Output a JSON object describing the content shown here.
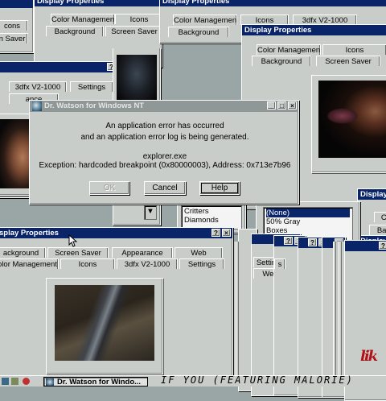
{
  "props": {
    "title": "Display Properties",
    "tab_color": "Color Management",
    "tab_icons": "Icons",
    "tab_3dfx": "3dfx V2-1000",
    "tab_background": "Background",
    "tab_screensaver": "Screen Saver",
    "tab_appearance": "Appearance",
    "tab_web": "Web",
    "tab_settings": "Settings",
    "frag_cons": "cons",
    "frag_saver": "n Saver",
    "frag_ance": "ance",
    "frag_3dfx": "3dfx V2-1000",
    "frag_ackground": "ackground",
    "frag_olor": "olor Management",
    "frag_display": "Display",
    "frag_co": "Co",
    "frag_bac": "Bac",
    "frag_splay": "splay Properties",
    "frag_layer": "Display Properties"
  },
  "list_patterns": {
    "items": [
      "Critters",
      "Diamonds"
    ]
  },
  "list_wallpaper": {
    "items": [
      "(None)",
      "50% Gray",
      "Boxes"
    ]
  },
  "small_tabs": {
    "settings": "Settings",
    "web": "Web",
    "frag_s": "s"
  },
  "dialog": {
    "title": "Dr. Watson for Windows NT",
    "line1": "An application error has occurred",
    "line2": "and an application error log is being generated.",
    "line3": "explorer.exe",
    "line4": "Exception: hardcoded breakpoint (0x80000003), Address: 0x713e7b96",
    "ok": "OK",
    "cancel": "Cancel",
    "help": "Help"
  },
  "taskbar": {
    "task_label": "Dr. Watson for Windo..."
  },
  "overlay": {
    "text": "IF YOU (FEATURING MALORIE)",
    "logo_mark": "lik"
  },
  "glyphs": {
    "help": "?",
    "close": "×",
    "min": "_",
    "max": "□",
    "scroll_down": "▼"
  },
  "colors": {
    "titlebar": "#0a246a",
    "face": "#c9cdca",
    "desktop": "#9aa6a6",
    "logo": "#b01218"
  }
}
